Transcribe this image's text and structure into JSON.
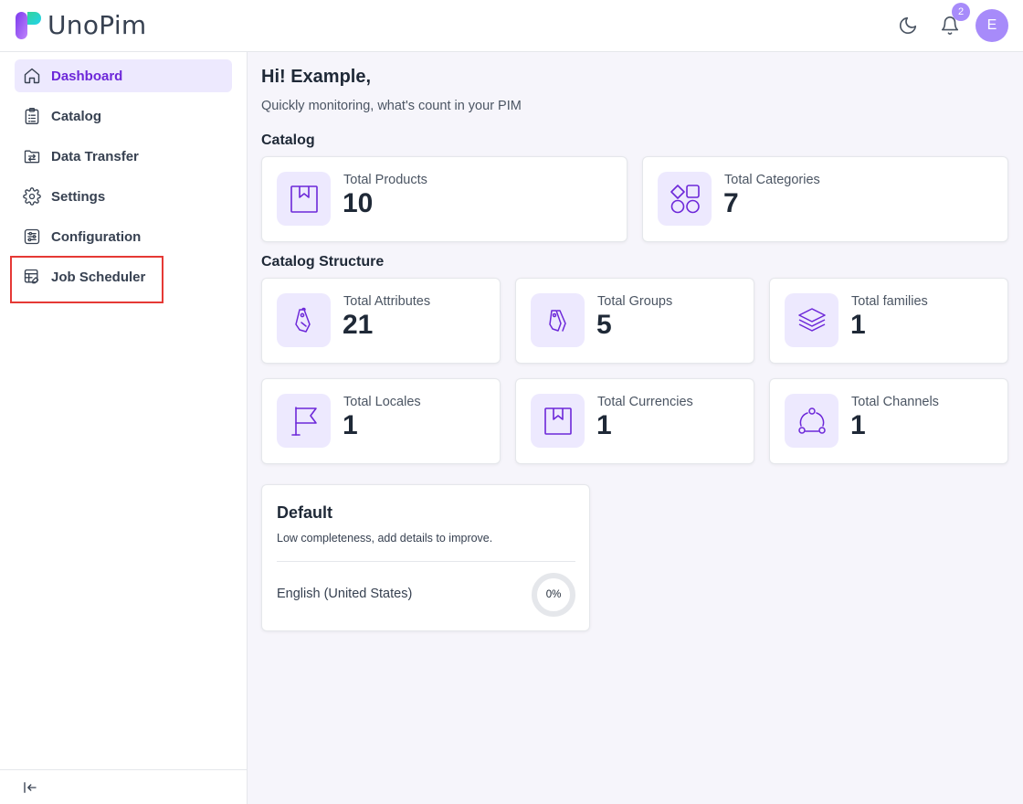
{
  "header": {
    "brand": "UnoPim",
    "notification_count": "2",
    "avatar_initial": "E"
  },
  "sidebar": {
    "items": [
      {
        "label": "Dashboard",
        "icon": "home-icon",
        "active": true
      },
      {
        "label": "Catalog",
        "icon": "clipboard-list-icon"
      },
      {
        "label": "Data Transfer",
        "icon": "folder-transfer-icon"
      },
      {
        "label": "Settings",
        "icon": "gear-icon"
      },
      {
        "label": "Configuration",
        "icon": "sliders-icon"
      },
      {
        "label": "Job Scheduler",
        "icon": "database-edit-icon"
      }
    ],
    "highlighted_item": "Job Scheduler",
    "highlight_color": "#e53935"
  },
  "main": {
    "greeting": "Hi! Example,",
    "subtitle": "Quickly monitoring, what's count in your PIM",
    "catalog": {
      "title": "Catalog",
      "cards": [
        {
          "label": "Total Products",
          "value": "10",
          "icon": "product-icon"
        },
        {
          "label": "Total Categories",
          "value": "7",
          "icon": "categories-icon"
        }
      ]
    },
    "structure": {
      "title": "Catalog Structure",
      "cards": [
        {
          "label": "Total Attributes",
          "value": "21",
          "icon": "tag-icon"
        },
        {
          "label": "Total Groups",
          "value": "5",
          "icon": "tags-icon"
        },
        {
          "label": "Total families",
          "value": "1",
          "icon": "layers-icon"
        },
        {
          "label": "Total Locales",
          "value": "1",
          "icon": "flag-icon"
        },
        {
          "label": "Total Currencies",
          "value": "1",
          "icon": "currency-icon"
        },
        {
          "label": "Total Channels",
          "value": "1",
          "icon": "channels-icon"
        }
      ]
    },
    "completeness": {
      "title": "Default",
      "subtitle": "Low completeness, add details to improve.",
      "locales": [
        {
          "name": "English (United States)",
          "percent_label": "0%",
          "percent": 0
        }
      ]
    }
  },
  "colors": {
    "accent": "#6d28d9",
    "accent_light": "#ede9fe",
    "badge": "#a78bfa"
  }
}
